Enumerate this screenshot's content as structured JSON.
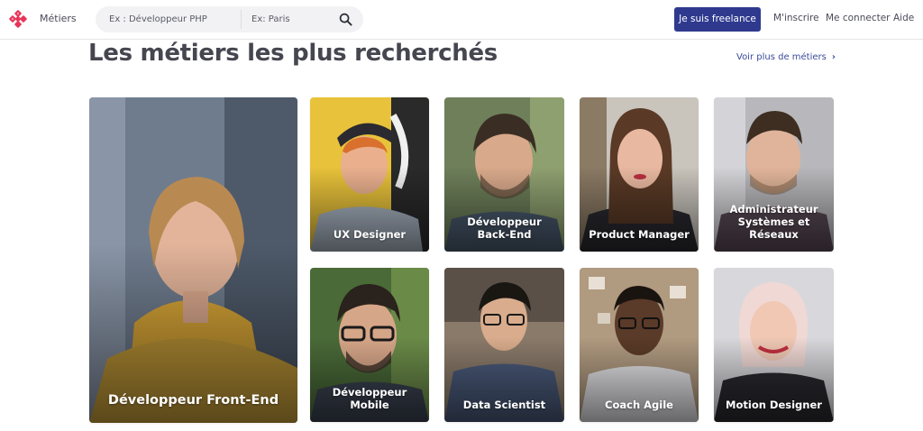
{
  "nav": {
    "metiers_label": "Métiers",
    "search_query_placeholder": "Ex : Développeur PHP",
    "search_location_placeholder": "Ex: Paris",
    "freelance_button": "Je suis freelance",
    "signup_link": "M'inscrire",
    "login_link": "Me connecter",
    "help_link": "Aide"
  },
  "section": {
    "title": "Les métiers les plus recherchés",
    "see_more": "Voir plus de métiers"
  },
  "cards": [
    {
      "label": "Développeur Front-End"
    },
    {
      "label": "UX Designer"
    },
    {
      "label": "Développeur Back-End"
    },
    {
      "label": "Product Manager"
    },
    {
      "label": "Administrateur Systèmes et Réseaux"
    },
    {
      "label": "Développeur Mobile"
    },
    {
      "label": "Data Scientist"
    },
    {
      "label": "Coach Agile"
    },
    {
      "label": "Motion Designer"
    }
  ],
  "colors": {
    "primary_button": "#2f3a8f",
    "link": "#3b4a9a",
    "logo": "#e8345a",
    "title": "#464650"
  },
  "icons": [
    "logo-icon",
    "search-icon",
    "chevron-right-icon"
  ]
}
